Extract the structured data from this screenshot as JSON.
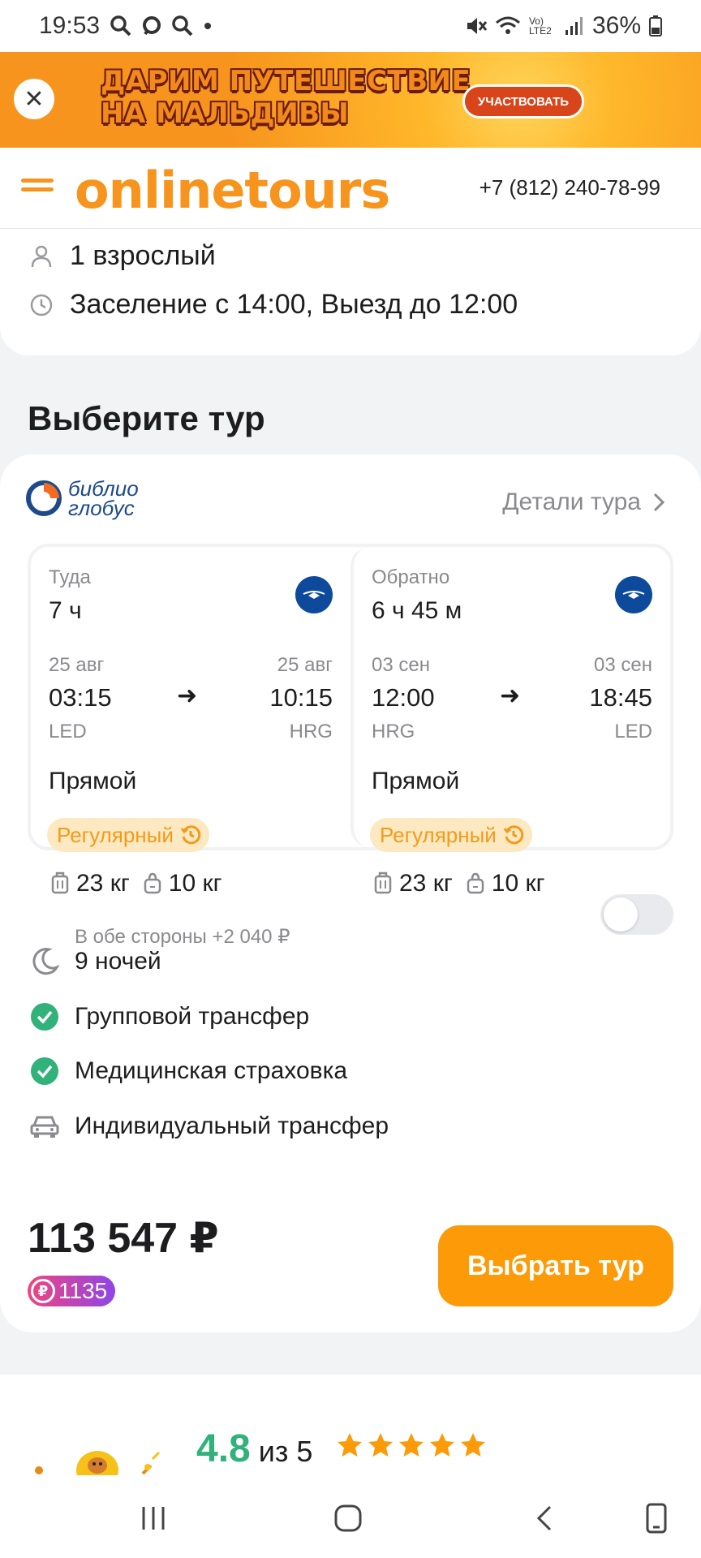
{
  "status": {
    "time": "19:53",
    "battery": "36%",
    "network": "Vo) LTE2"
  },
  "banner": {
    "line1": "ДАРИМ ПУТЕШЕСТВИЕ",
    "line2": "НА МАЛЬДИВЫ",
    "cta": "УЧАСТВОВАТЬ",
    "close": "✕"
  },
  "header": {
    "logo": "onlinetours",
    "phone": "+7 (812) 240-78-99"
  },
  "info": {
    "guests": "1 взрослый",
    "checkin": "Заселение с 14:00, Выезд до 12:00"
  },
  "section_title": "Выберите тур",
  "tour": {
    "operator_line1": "библио",
    "operator_line2": "глобус",
    "details_label": "Детали тура",
    "outbound": {
      "direction": "Туда",
      "duration": "7 ч",
      "dep_date": "25 авг",
      "arr_date": "25 авг",
      "dep_time": "03:15",
      "arr_time": "10:15",
      "dep_code": "LED",
      "arr_code": "HRG",
      "type": "Прямой",
      "badge": "Регулярный",
      "baggage": "23 кг",
      "hand": "10 кг"
    },
    "return": {
      "direction": "Обратно",
      "duration": "6 ч 45 м",
      "dep_date": "03 сен",
      "arr_date": "03 сен",
      "dep_time": "12:00",
      "arr_time": "18:45",
      "dep_code": "HRG",
      "arr_code": "LED",
      "type": "Прямой",
      "badge": "Регулярный",
      "baggage": "23 кг",
      "hand": "10 кг"
    },
    "arrow": "➜",
    "features": {
      "nights": "9 ночей",
      "transfer": "Групповой трансфер",
      "insurance": "Медицинская страховка",
      "individual": "Индивидуальный трансфер",
      "individual_sub": "В обе стороны +2 040 ₽",
      "individual_enabled": false
    },
    "price": "113 547 ₽",
    "bonus": "1135",
    "choose_label": "Выбрать тур"
  },
  "rating": {
    "value": "4.8",
    "of": "из 5",
    "stars": 5
  },
  "colors": {
    "accent": "#fd9a08",
    "green": "#30b27a",
    "brand_orange": "#f7941d"
  }
}
